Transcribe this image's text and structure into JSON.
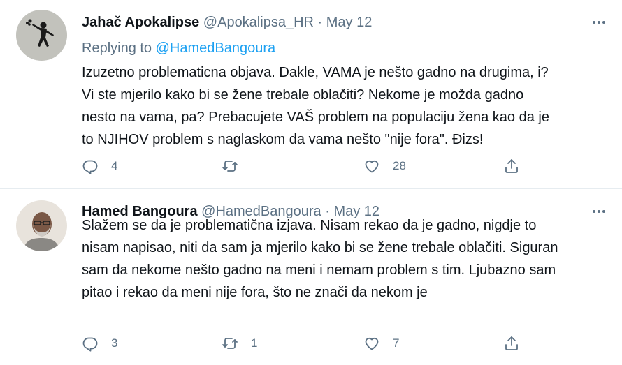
{
  "tweets": [
    {
      "display_name": "Jahač Apokalipse",
      "handle": "@Apokalipsa_HR",
      "separator": "·",
      "date": "May 12",
      "replying_prefix": "Replying to",
      "replying_handle": "@HamedBangoura",
      "text": "Izuzetno problematicna objava. Dakle, VAMA je nešto gadno na drugima, i?\nVi ste mjerilo kako bi se žene trebale oblačiti? Nekome je možda gadno\nnesto na vama, pa?  Prebacujete VAŠ problem na populaciju žena kao da je\nto NJIHOV problem s naglaskom da vama nešto \"nije fora\". Đizs!",
      "reply_count": "4",
      "retweet_count": "",
      "like_count": "28",
      "avatar_icon": "graffiti-flower-thrower-avatar"
    },
    {
      "display_name": "Hamed Bangoura",
      "handle": "@HamedBangoura",
      "separator": "·",
      "date": "May 12",
      "text": "Slažem se da je problematična izjava. Nisam rekao da je gadno, nigdje to\nnisam napisao, niti da sam ja mjerilo kako bi se žene trebale oblačiti. Siguran\nsam da nekome nešto gadno na meni i nemam problem s tim. Ljubazno sam\npitao i rekao da meni nije fora, što ne znači da nekom je",
      "reply_count": "3",
      "retweet_count": "1",
      "like_count": "7",
      "avatar_icon": "bald-man-glasses-avatar"
    }
  ],
  "colors": {
    "text": "#0f1419",
    "muted": "#5b7083",
    "link": "#1da1f2",
    "divider": "#e6ecf0"
  }
}
